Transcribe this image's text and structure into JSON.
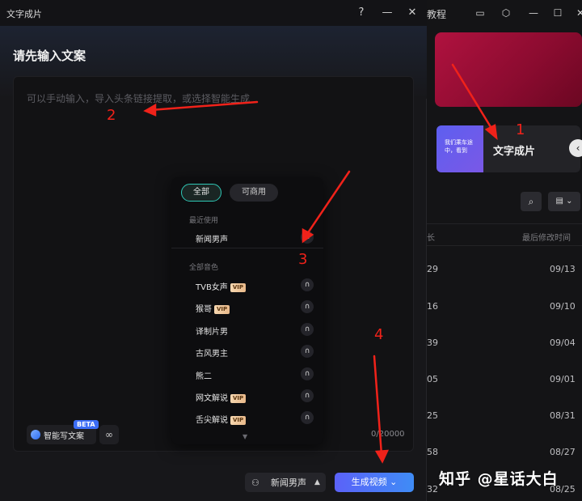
{
  "window": {
    "title": "文字成片"
  },
  "dialog": {
    "heading": "请先输入文案",
    "editor_placeholder": "可以手动输入，导入头条链接提取，或选择智能生成",
    "ai_write_label": "智能写文案",
    "beta_badge": "BETA",
    "char_counter": "0/20000",
    "voice_button_label": "新闻男声",
    "generate_button_label": "生成视频"
  },
  "voice_dropdown": {
    "tabs": [
      {
        "label": "全部",
        "active": true
      },
      {
        "label": "可商用",
        "active": false
      }
    ],
    "recent_section": "最近使用",
    "recent_items": [
      {
        "name": "新闻男声",
        "vip": false
      }
    ],
    "all_section": "全部音色",
    "all_items": [
      {
        "name": "TVB女声",
        "vip": true
      },
      {
        "name": "猴哥",
        "vip": true
      },
      {
        "name": "译制片男",
        "vip": false
      },
      {
        "name": "古风男主",
        "vip": false
      },
      {
        "name": "熊二",
        "vip": false
      },
      {
        "name": "网文解说",
        "vip": true
      },
      {
        "name": "舌尖解说",
        "vip": true
      }
    ],
    "vip_label": "VIP"
  },
  "background_app": {
    "tutorial_label": "教程",
    "card_thumb_text": "我们乘车途中，看到",
    "card_title": "文字成片",
    "column_headers": [
      "长",
      "最后修改时间"
    ],
    "rows": [
      {
        "a": "29",
        "b": "09/13"
      },
      {
        "a": "16",
        "b": "09/10"
      },
      {
        "a": "39",
        "b": "09/04"
      },
      {
        "a": "05",
        "b": "09/01"
      },
      {
        "a": "25",
        "b": "08/31"
      },
      {
        "a": "58",
        "b": "08/27"
      },
      {
        "a": "32",
        "b": "08/25"
      }
    ]
  },
  "annotations": [
    "1",
    "2",
    "3",
    "4"
  ],
  "watermark": "知乎 @星话大白",
  "colors": {
    "accent_teal": "#2fc7b5",
    "generate_gradient_start": "#5b62f8",
    "generate_gradient_end": "#3f8cf6",
    "annotation_red": "#f0221a",
    "hero_red": "#b0123f"
  }
}
